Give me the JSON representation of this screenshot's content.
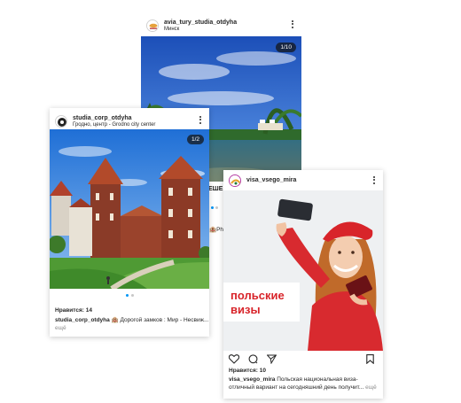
{
  "posts": [
    {
      "username": "avia_tury_studia_otdyha",
      "location": "Минск",
      "counter": "1/10"
    },
    {
      "username": "studia_corp_otdyha",
      "location": "Гродно, центр - Grodno city center",
      "counter": "1/2",
      "likes": "Нравится: 14",
      "caption_user": "studia_corp_otdyha",
      "caption_text": "🏨 Дорогой замков : Мир - Несвиж...",
      "more": "ещё"
    },
    {
      "username": "visa_vsego_mira",
      "overlay_text": "польские визы",
      "likes": "Нравится: 10",
      "caption_user": "visa_vsego_mira",
      "caption_text": "Польская национальная виза-",
      "caption_line2": "отличный вариант на сегодняшний день получит...",
      "more": "ещё"
    }
  ],
  "peek": {
    "fragment_top": "ЕШЕ",
    "fragment_mid": "🏨Ph"
  },
  "colors": {
    "accent": "#0095f6",
    "visa_red": "#d8242a"
  }
}
